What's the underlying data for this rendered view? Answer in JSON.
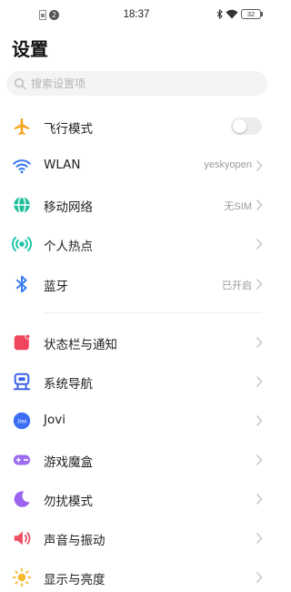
{
  "status_bar": {
    "time": "18:37",
    "notification_count": "2",
    "battery": "32"
  },
  "page": {
    "title": "设置"
  },
  "search": {
    "placeholder": "搜索设置项"
  },
  "group1": [
    {
      "id": "airplane",
      "label": "飞行模式",
      "icon": "airplane-icon",
      "type": "toggle",
      "enabled": false
    },
    {
      "id": "wlan",
      "label": "WLAN",
      "icon": "wifi-icon",
      "value": "yeskyopen"
    },
    {
      "id": "mobile-network",
      "label": "移动网络",
      "icon": "globe-icon",
      "value": "无SIM"
    },
    {
      "id": "hotspot",
      "label": "个人热点",
      "icon": "hotspot-icon",
      "value": ""
    },
    {
      "id": "bluetooth",
      "label": "蓝牙",
      "icon": "bluetooth-icon",
      "value": "已开启"
    }
  ],
  "group2": [
    {
      "id": "statusbar-notifications",
      "label": "状态栏与通知",
      "icon": "notification-icon"
    },
    {
      "id": "system-navigation",
      "label": "系统导航",
      "icon": "navigation-robot-icon"
    },
    {
      "id": "jovi",
      "label": "Jovi",
      "icon": "jovi-icon",
      "icon_text": "Jovi"
    },
    {
      "id": "game-box",
      "label": "游戏魔盒",
      "icon": "gamepad-icon"
    },
    {
      "id": "do-not-disturb",
      "label": "勿扰模式",
      "icon": "moon-icon"
    },
    {
      "id": "sound-vibration",
      "label": "声音与振动",
      "icon": "speaker-icon"
    },
    {
      "id": "display-brightness",
      "label": "显示与亮度",
      "icon": "sun-icon"
    }
  ],
  "colors": {
    "airplane": "#f5a623",
    "wifi": "#3b7cf0",
    "globe": "#1fbf9a",
    "hotspot": "#1fc6a6",
    "bluetooth": "#3b7cf0",
    "notification": "#f0455e",
    "navigation": "#3b63e8",
    "jovi": "#3b6ef5",
    "gamepad": "#9b6cf0",
    "moon": "#9b63f0",
    "speaker": "#f04f63",
    "sun": "#f7b733"
  }
}
